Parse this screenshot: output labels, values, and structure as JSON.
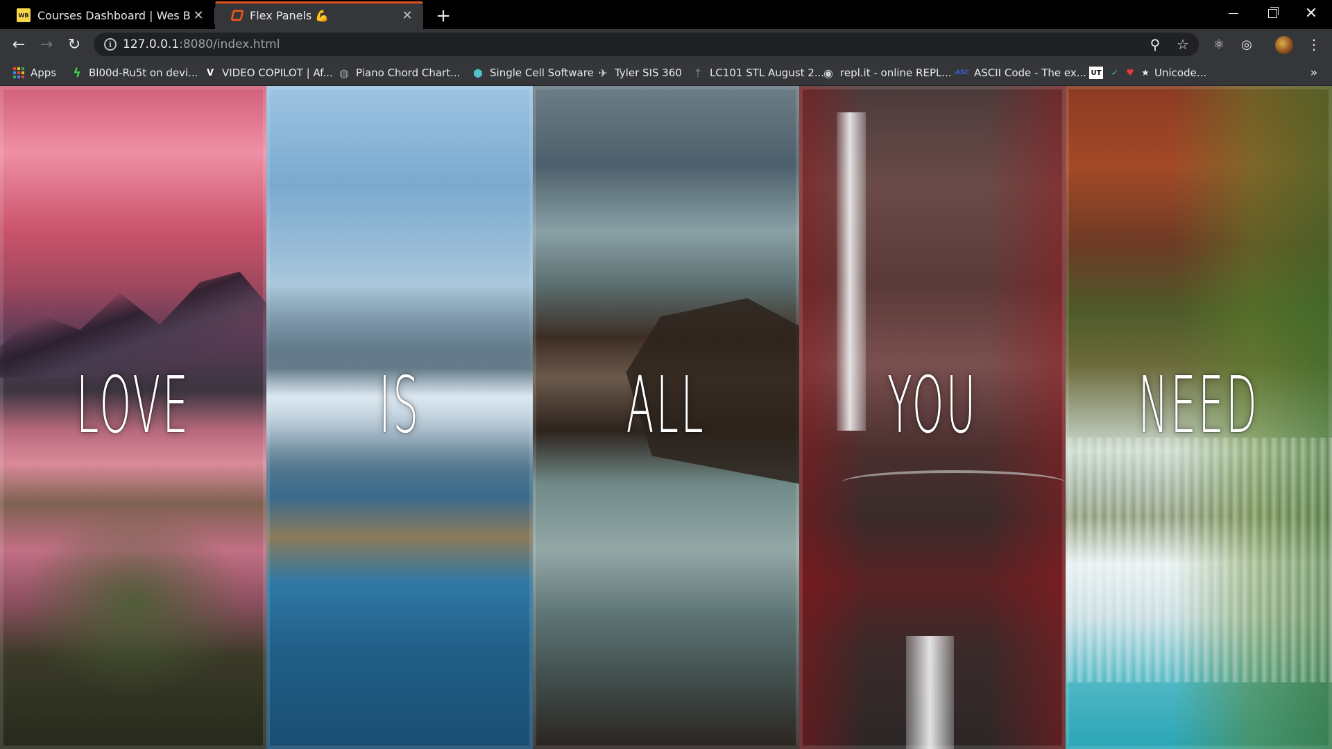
{
  "browser": {
    "tabs": [
      {
        "title": "Courses Dashboard | Wes Bos",
        "active": false,
        "favicon": "wesbos-icon"
      },
      {
        "title": "Flex Panels 💪",
        "active": true,
        "favicon": "flex-panels-icon"
      }
    ],
    "address": {
      "host": "127.0.0.1",
      "rest": ":8080/index.html"
    },
    "accent_color": "#e0531f",
    "bookmarks": [
      {
        "label": "Apps",
        "icon": "apps-grid-icon"
      },
      {
        "label": "Bl00d-Ru5t on devi...",
        "icon": "deviantart-icon",
        "color": "#3ecf4a"
      },
      {
        "label": "VIDEO COPILOT | Af...",
        "icon": "videocopilot-icon",
        "glyph": "V"
      },
      {
        "label": "Piano Chord Chart...",
        "icon": "globe-icon"
      },
      {
        "label": "Single Cell Software",
        "icon": "cube-icon",
        "color": "#4fc3c9"
      },
      {
        "label": "Tyler SIS 360",
        "icon": "tyler-icon"
      },
      {
        "label": "LC101 STL August 2...",
        "icon": "launchcode-icon"
      },
      {
        "label": "repl.it - online REPL...",
        "icon": "replit-icon"
      },
      {
        "label": "ASCII Code - The ex...",
        "icon": "ascii-icon",
        "glyph": "ASC"
      },
      {
        "label": "Unicode...",
        "icon": "unicode-icon",
        "glyph": "UT"
      }
    ]
  },
  "panels": [
    {
      "word": "LOVE"
    },
    {
      "word": "IS"
    },
    {
      "word": "ALL"
    },
    {
      "word": "YOU"
    },
    {
      "word": "NEED"
    }
  ]
}
